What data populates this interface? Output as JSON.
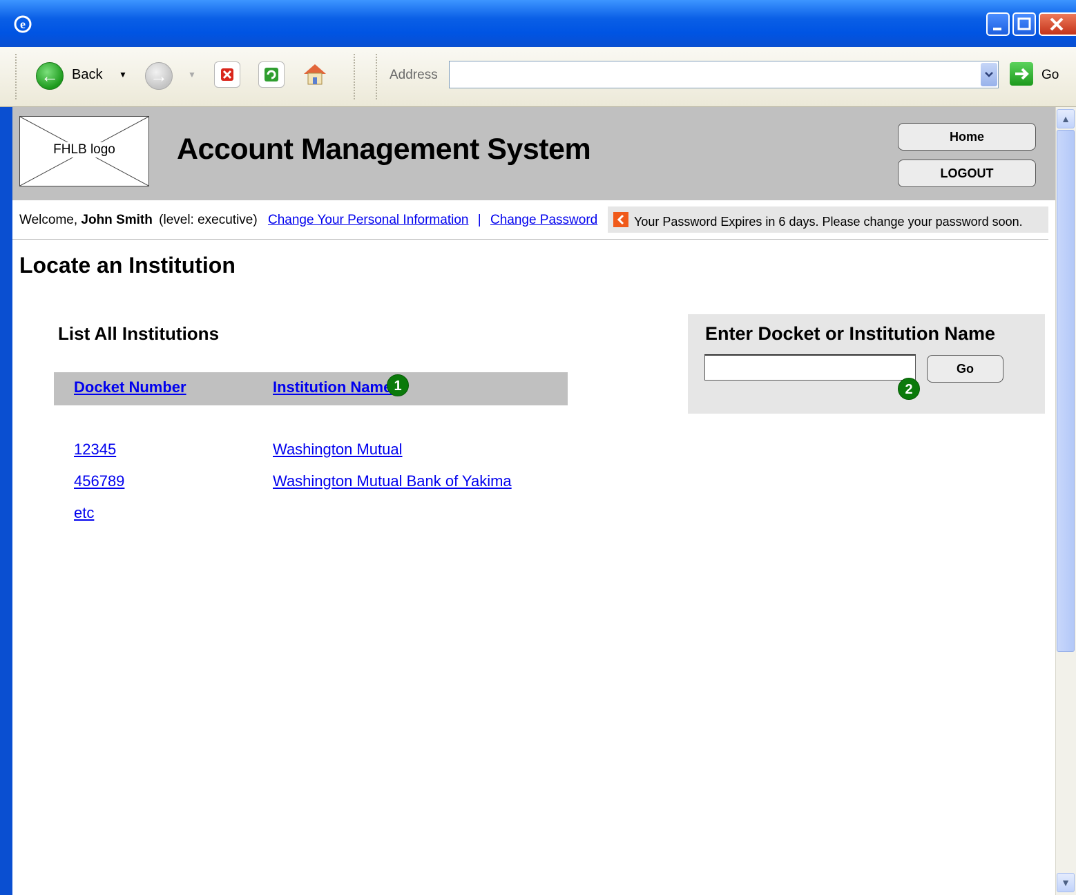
{
  "browser": {
    "back_label": "Back",
    "address_label": "Address",
    "address_value": "",
    "go_label": "Go"
  },
  "header": {
    "logo_text": "FHLB logo",
    "title": "Account Management System",
    "home_button": "Home",
    "logout_button": "LOGOUT"
  },
  "welcome": {
    "prefix": "Welcome,",
    "user_name": "John Smith",
    "level": "(level: executive)",
    "change_info_link": "Change Your Personal Information",
    "separator": "|",
    "change_password_link": "Change Password",
    "password_notice": "Your Password Expires in 6 days. Please change your password soon."
  },
  "page": {
    "title": "Locate an Institution",
    "list_title": "List All Institutions"
  },
  "table": {
    "columns": [
      "Docket Number",
      "Institution Name"
    ],
    "rows": [
      {
        "docket": "12345",
        "name": "Washington Mutual"
      },
      {
        "docket": "456789",
        "name": "Washington Mutual Bank of Yakima"
      },
      {
        "docket": "etc",
        "name": ""
      }
    ]
  },
  "search": {
    "title": "Enter Docket or Institution Name",
    "input_value": "",
    "go_button": "Go"
  },
  "annotations": {
    "badge1": "1",
    "badge2": "2"
  },
  "colors": {
    "header_gray": "#c0c0c0",
    "link_blue": "#0000ee",
    "badge_green": "#0b7a0b",
    "alert_orange": "#f05a1a"
  }
}
